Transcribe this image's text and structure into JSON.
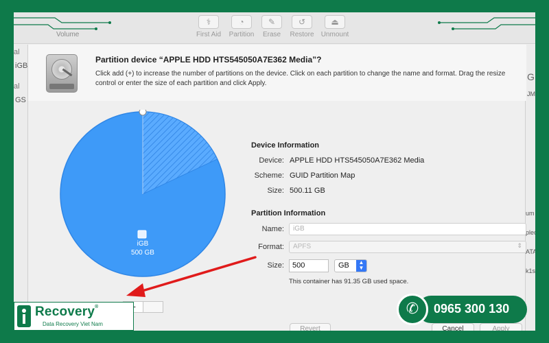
{
  "toolbar": {
    "volume_label": "Volume",
    "buttons": [
      {
        "label": "First Aid",
        "icon": "stethoscope-icon",
        "glyph": "⚕"
      },
      {
        "label": "Partition",
        "icon": "pie-icon",
        "glyph": "◔"
      },
      {
        "label": "Erase",
        "icon": "erase-icon",
        "glyph": "✎"
      },
      {
        "label": "Restore",
        "icon": "restore-icon",
        "glyph": "↺"
      },
      {
        "label": "Unmount",
        "icon": "eject-icon",
        "glyph": "⏏"
      }
    ]
  },
  "sidebar_fragments": [
    "al",
    "iGB",
    "al",
    "GS"
  ],
  "right_fragments": [
    "GB",
    "JME",
    "um",
    "plec",
    "ATA",
    "k1s"
  ],
  "sheet": {
    "title": "Partition device “APPLE HDD HTS545050A7E362 Media”?",
    "description": "Click add (+) to increase the number of partitions on the device. Click on each partition to change the name and format. Drag the resize control or enter the size of each partition and click Apply."
  },
  "pie": {
    "partition_name": "iGB",
    "partition_size": "500 GB",
    "used_fraction": 0.18,
    "color": "#3e9af8"
  },
  "buttons": {
    "add": "+",
    "revert": "Revert",
    "cancel": "Cancel",
    "apply": "Apply"
  },
  "device_info": {
    "heading": "Device Information",
    "device_label": "Device:",
    "device_value": "APPLE HDD HTS545050A7E362 Media",
    "scheme_label": "Scheme:",
    "scheme_value": "GUID Partition Map",
    "size_label": "Size:",
    "size_value": "500.11 GB"
  },
  "partition_info": {
    "heading": "Partition Information",
    "name_label": "Name:",
    "name_placeholder": "iGB",
    "format_label": "Format:",
    "format_value": "APFS",
    "size_label": "Size:",
    "size_value": "500",
    "size_unit": "GB",
    "note": "This container has 91.35 GB used space."
  },
  "branding": {
    "name": "Recovery",
    "reg": "®",
    "subtitle": "Data Recovery Viet Nam",
    "phone": "0965 300 130"
  },
  "colors": {
    "brand_green": "#0e7a4a",
    "accent_blue": "#3478f6",
    "arrow_red": "#e01b1b"
  }
}
